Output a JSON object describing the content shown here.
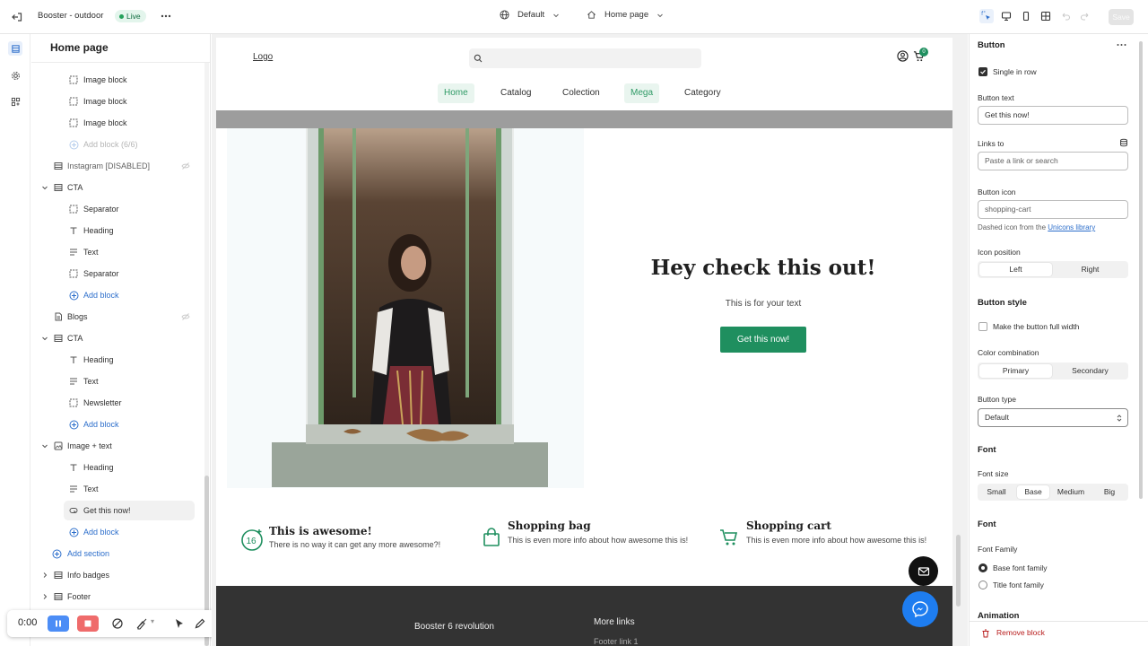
{
  "topbar": {
    "store_name": "Booster - outdoor",
    "status_badge": "Live",
    "theme_select": "Default",
    "page_select": "Home page",
    "save_label": "Save"
  },
  "sidebar": {
    "title": "Home page",
    "items": [
      {
        "label": "Image block",
        "type": "block",
        "icon": "image-block-icon"
      },
      {
        "label": "Image block",
        "type": "block",
        "icon": "image-block-icon"
      },
      {
        "label": "Image block",
        "type": "block",
        "icon": "image-block-icon"
      },
      {
        "label": "Add block (6/6)",
        "type": "add-disabled",
        "icon": "plus-circle-icon"
      },
      {
        "label": "Instagram [DISABLED]",
        "type": "section-disabled",
        "icon": "section-icon"
      },
      {
        "label": "CTA",
        "type": "section",
        "icon": "section-icon"
      },
      {
        "label": "Separator",
        "type": "block",
        "icon": "image-block-icon"
      },
      {
        "label": "Heading",
        "type": "block",
        "icon": "text-t-icon"
      },
      {
        "label": "Text",
        "type": "block",
        "icon": "text-lines-icon"
      },
      {
        "label": "Separator",
        "type": "block",
        "icon": "image-block-icon"
      },
      {
        "label": "Add block",
        "type": "add",
        "icon": "plus-circle-icon"
      },
      {
        "label": "Blogs",
        "type": "section-plain",
        "icon": "blog-icon"
      },
      {
        "label": "CTA",
        "type": "section",
        "icon": "section-icon"
      },
      {
        "label": "Heading",
        "type": "block",
        "icon": "text-t-icon"
      },
      {
        "label": "Text",
        "type": "block",
        "icon": "text-lines-icon"
      },
      {
        "label": "Newsletter",
        "type": "block",
        "icon": "image-block-icon"
      },
      {
        "label": "Add block",
        "type": "add",
        "icon": "plus-circle-icon"
      },
      {
        "label": "Image + text",
        "type": "section",
        "icon": "image-text-icon"
      },
      {
        "label": "Heading",
        "type": "block",
        "icon": "text-t-icon"
      },
      {
        "label": "Text",
        "type": "block",
        "icon": "text-lines-icon"
      },
      {
        "label": "Get this now!",
        "type": "block-selected",
        "icon": "button-icon"
      },
      {
        "label": "Add block",
        "type": "add",
        "icon": "plus-circle-icon"
      },
      {
        "label": "Add section",
        "type": "add-section",
        "icon": "plus-circle-icon"
      },
      {
        "label": "Info badges",
        "type": "section-collapsed",
        "icon": "section-icon"
      },
      {
        "label": "Footer",
        "type": "section-collapsed",
        "icon": "section-icon"
      }
    ]
  },
  "player": {
    "time": "0:00"
  },
  "preview": {
    "logo": "Logo",
    "nav": [
      "Home",
      "Catalog",
      "Colection",
      "Mega",
      "Category"
    ],
    "cart_count": "0",
    "cta": {
      "heading": "Hey check this out!",
      "text": "This is for your text",
      "button": "Get this now!"
    },
    "features": [
      {
        "title": "This is awesome!",
        "desc": "There is no way it can get any more awesome?!",
        "icon": "sixteen-badge-icon"
      },
      {
        "title": "Shopping bag",
        "desc": "This is even more info about how awesome this is!",
        "icon": "shopping-bag-icon"
      },
      {
        "title": "Shopping cart",
        "desc": "This is even more info about how awesome this is!",
        "icon": "shopping-cart-icon"
      }
    ],
    "footer": {
      "col1": "Booster 6 revolution",
      "col2": "More links",
      "col3": "Footer link 1"
    }
  },
  "settings": {
    "title": "Button",
    "single_in_row": "Single in row",
    "button_text_label": "Button text",
    "button_text_value": "Get this now!",
    "links_to_label": "Links to",
    "links_to_placeholder": "Paste a link or search",
    "button_icon_label": "Button icon",
    "button_icon_value": "shopping-cart",
    "icon_help_prefix": "Dashed icon from the",
    "icon_help_link": "Unicons library",
    "icon_position_label": "Icon position",
    "icon_position_options": [
      "Left",
      "Right"
    ],
    "icon_position_selected": "Right",
    "button_style_heading": "Button style",
    "full_width_label": "Make the button full width",
    "color_combo_label": "Color combination",
    "color_combo_options": [
      "Primary",
      "Secondary"
    ],
    "color_combo_selected": "Primary",
    "button_type_label": "Button type",
    "button_type_value": "Default",
    "font_heading": "Font",
    "font_size_label": "Font size",
    "font_size_options": [
      "Small",
      "Base",
      "Medium",
      "Big"
    ],
    "font_size_selected": "Base",
    "font_heading_2": "Font",
    "font_family_label": "Font Family",
    "font_family_options": [
      "Base font family",
      "Title font family"
    ],
    "font_family_selected": "Base font family",
    "animation_heading": "Animation",
    "remove_block": "Remove block"
  },
  "colors": {
    "accent_green": "#1f8f5f",
    "live_badge_bg": "#e3f5ec",
    "link_blue": "#2c6ecb",
    "remove_red": "#b81c1c"
  }
}
